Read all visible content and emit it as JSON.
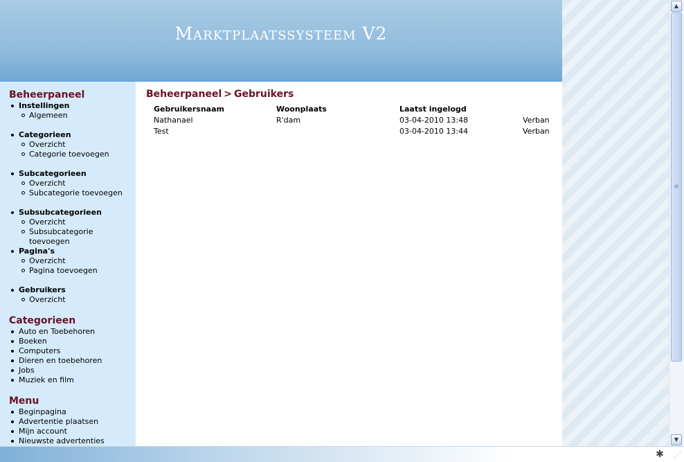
{
  "site": {
    "title": "Marktplaatssysteem V2"
  },
  "sidebar": {
    "admin": {
      "heading": "Beheerpaneel",
      "groups": [
        {
          "title": "Instellingen",
          "items": [
            "Algemeen"
          ]
        },
        {
          "title": "Categorieen",
          "items": [
            "Overzicht",
            "Categorie toevoegen"
          ]
        },
        {
          "title": "Subcategorieen",
          "items": [
            "Overzicht",
            "Subcategorie toevoegen"
          ]
        },
        {
          "title": "Subsubcategorieen",
          "items": [
            "Overzicht",
            "Subsubcategorie toevoegen"
          ]
        },
        {
          "title": "Pagina's",
          "items": [
            "Overzicht",
            "Pagina toevoegen"
          ]
        },
        {
          "title": "Gebruikers",
          "items": [
            "Overzicht"
          ]
        }
      ]
    },
    "categories": {
      "heading": "Categorieen",
      "items": [
        "Auto en Toebehoren",
        "Boeken",
        "Computers",
        "Dieren en toebehoren",
        "Jobs",
        "Muziek en film"
      ]
    },
    "menu": {
      "heading": "Menu",
      "items": [
        "Beginpagina",
        "Advertentie plaatsen",
        "Mijn account",
        "Nieuwste advertenties"
      ]
    }
  },
  "main": {
    "breadcrumb": {
      "parent": "Beheerpaneel",
      "separator": ">",
      "current": "Gebruikers"
    },
    "table": {
      "columns": [
        "Gebruikersnaam",
        "Woonplaats",
        "Laatst ingelogd",
        ""
      ],
      "rows": [
        {
          "username": "Nathanael",
          "city": "R'dam",
          "last_login": "03-04-2010 13:48",
          "action": "Verban"
        },
        {
          "username": "Test",
          "city": "",
          "last_login": "03-04-2010 13:44",
          "action": "Verban"
        }
      ]
    }
  },
  "icons": {
    "scroll_up": "arrow-up-icon",
    "scroll_down": "arrow-down-icon",
    "status": "bug-icon"
  },
  "colors": {
    "heading": "#6b1023",
    "sidebar_bg": "#d5ebfb",
    "banner_top": "#a9cbe2",
    "banner_bottom": "#6fa6d3"
  }
}
